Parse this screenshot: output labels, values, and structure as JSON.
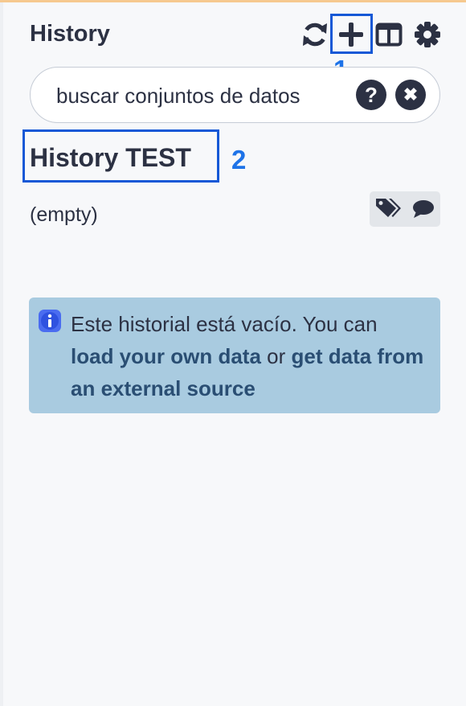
{
  "panel": {
    "title": "History"
  },
  "toolbar": {
    "icons": [
      "sync-icon",
      "plus-icon",
      "columns-icon",
      "gear-icon"
    ]
  },
  "annotations": {
    "one": "1",
    "two": "2"
  },
  "search": {
    "placeholder": "buscar conjuntos de datos",
    "help_label": "?",
    "clear_label": "✖"
  },
  "history": {
    "name": "History TEST",
    "size": "(empty)"
  },
  "empty_message": {
    "prefix": "Este historial está vacío. You can",
    "link_own": "load your own data",
    "middle": "or",
    "link_external": "get data from an external source"
  },
  "colors": {
    "annotation_blue": "#1e73e8",
    "info_bg": "#a9cbe0",
    "text_dark": "#2c3143",
    "link": "#2a4e73"
  }
}
